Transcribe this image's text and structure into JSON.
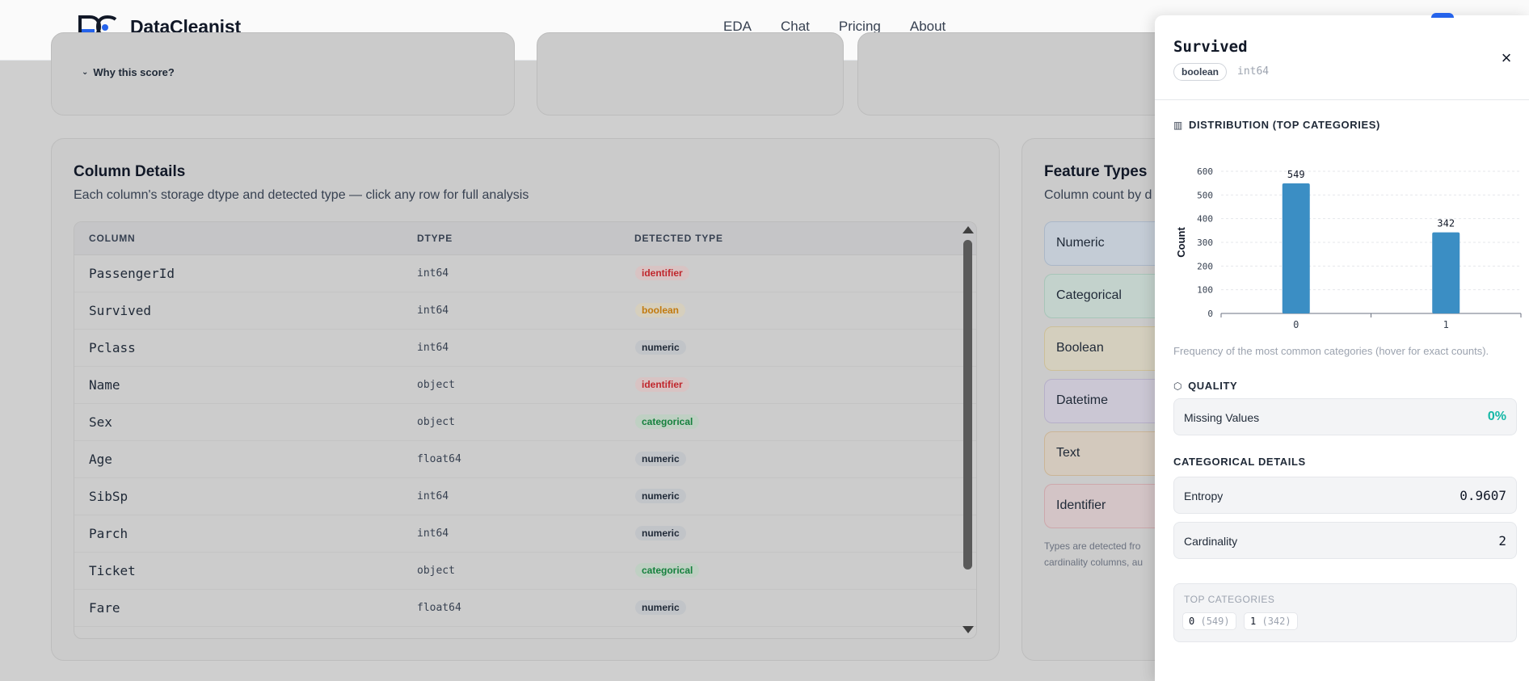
{
  "brand": {
    "name": "DataCleanist"
  },
  "nav": {
    "items": [
      "EDA",
      "Chat",
      "Pricing",
      "About"
    ]
  },
  "score_card": {
    "why_label": "Why this score?"
  },
  "column_details": {
    "title": "Column Details",
    "subtitle": "Each column's storage dtype and detected type — click any row for full analysis",
    "headers": {
      "column": "COLUMN",
      "dtype": "DTYPE",
      "detected": "DETECTED TYPE"
    },
    "rows": [
      {
        "column": "PassengerId",
        "dtype": "int64",
        "detected": "identifier"
      },
      {
        "column": "Survived",
        "dtype": "int64",
        "detected": "boolean"
      },
      {
        "column": "Pclass",
        "dtype": "int64",
        "detected": "numeric"
      },
      {
        "column": "Name",
        "dtype": "object",
        "detected": "identifier"
      },
      {
        "column": "Sex",
        "dtype": "object",
        "detected": "categorical"
      },
      {
        "column": "Age",
        "dtype": "float64",
        "detected": "numeric"
      },
      {
        "column": "SibSp",
        "dtype": "int64",
        "detected": "numeric"
      },
      {
        "column": "Parch",
        "dtype": "int64",
        "detected": "numeric"
      },
      {
        "column": "Ticket",
        "dtype": "object",
        "detected": "categorical"
      },
      {
        "column": "Fare",
        "dtype": "float64",
        "detected": "numeric"
      }
    ]
  },
  "feature_types": {
    "title": "Feature Types",
    "subtitle": "Column count by d",
    "items": [
      {
        "label": "Numeric",
        "bg": "#c4ccd6",
        "border": "#aab7c8"
      },
      {
        "label": "Categorical",
        "bg": "#c3d2cc",
        "border": "#a7c5b8"
      },
      {
        "label": "Boolean",
        "bg": "#d4cfbe",
        "border": "#cdbf98"
      },
      {
        "label": "Datetime",
        "bg": "#cbc7d4",
        "border": "#b6afc9"
      },
      {
        "label": "Text",
        "bg": "#d3c9bd",
        "border": "#cbb596"
      },
      {
        "label": "Identifier",
        "bg": "#d3c4c6",
        "border": "#cda7ab"
      }
    ],
    "note_line1": "Types are detected fro",
    "note_line2": "cardinality columns, au"
  },
  "panel": {
    "title": "Survived",
    "detected_badge": "boolean",
    "dtype": "int64",
    "close_icon": "×",
    "distribution_heading": "DISTRIBUTION (TOP CATEGORIES)",
    "distribution_caption": "Frequency of the most common categories (hover for exact counts).",
    "quality_heading": "QUALITY",
    "missing_label": "Missing Values",
    "missing_value": "0%",
    "categorical_heading": "CATEGORICAL DETAILS",
    "entropy_label": "Entropy",
    "entropy_value": "0.9607",
    "cardinality_label": "Cardinality",
    "cardinality_value": "2",
    "top_categories_label": "TOP CATEGORIES",
    "top_categories": [
      {
        "name": "0",
        "count": "(549)"
      },
      {
        "name": "1",
        "count": "(342)"
      }
    ]
  },
  "colors": {
    "bar": "#3b8ec4",
    "accent_teal": "#14b8a6"
  },
  "chart_data": {
    "type": "bar",
    "categories": [
      "0",
      "1"
    ],
    "values": [
      549,
      342
    ],
    "ylabel": "Count",
    "xlabel": "",
    "ylim": [
      0,
      600
    ],
    "yticks": [
      0,
      100,
      200,
      300,
      400,
      500,
      600
    ],
    "grid": true,
    "data_labels": true
  }
}
